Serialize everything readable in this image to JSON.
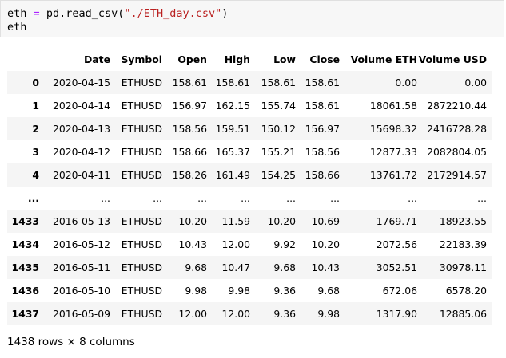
{
  "code": {
    "line1": {
      "var": "eth",
      "op": "=",
      "call": "pd.read_csv(",
      "arg": "\"./ETH_day.csv\"",
      "close": ")"
    },
    "line2": "eth"
  },
  "table": {
    "columns": [
      "",
      "Date",
      "Symbol",
      "Open",
      "High",
      "Low",
      "Close",
      "Volume ETH",
      "Volume USD"
    ],
    "rows": [
      [
        "0",
        "2020-04-15",
        "ETHUSD",
        "158.61",
        "158.61",
        "158.61",
        "158.61",
        "0.00",
        "0.00"
      ],
      [
        "1",
        "2020-04-14",
        "ETHUSD",
        "156.97",
        "162.15",
        "155.74",
        "158.61",
        "18061.58",
        "2872210.44"
      ],
      [
        "2",
        "2020-04-13",
        "ETHUSD",
        "158.56",
        "159.51",
        "150.12",
        "156.97",
        "15698.32",
        "2416728.28"
      ],
      [
        "3",
        "2020-04-12",
        "ETHUSD",
        "158.66",
        "165.37",
        "155.21",
        "158.56",
        "12877.33",
        "2082804.05"
      ],
      [
        "4",
        "2020-04-11",
        "ETHUSD",
        "158.26",
        "161.49",
        "154.25",
        "158.66",
        "13761.72",
        "2172914.57"
      ],
      [
        "...",
        "...",
        "...",
        "...",
        "...",
        "...",
        "...",
        "...",
        "..."
      ],
      [
        "1433",
        "2016-05-13",
        "ETHUSD",
        "10.20",
        "11.59",
        "10.20",
        "10.69",
        "1769.71",
        "18923.55"
      ],
      [
        "1434",
        "2016-05-12",
        "ETHUSD",
        "10.43",
        "12.00",
        "9.92",
        "10.20",
        "2072.56",
        "22183.39"
      ],
      [
        "1435",
        "2016-05-11",
        "ETHUSD",
        "9.68",
        "10.47",
        "9.68",
        "10.43",
        "3052.51",
        "30978.11"
      ],
      [
        "1436",
        "2016-05-10",
        "ETHUSD",
        "9.98",
        "9.98",
        "9.36",
        "9.68",
        "672.06",
        "6578.20"
      ],
      [
        "1437",
        "2016-05-09",
        "ETHUSD",
        "12.00",
        "12.00",
        "9.36",
        "9.98",
        "1317.90",
        "12885.06"
      ]
    ]
  },
  "footer": "1438 rows × 8 columns"
}
